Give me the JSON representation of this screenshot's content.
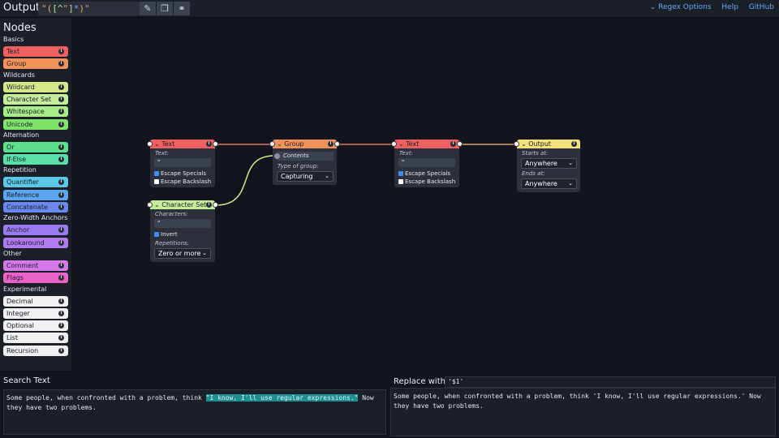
{
  "topbar": {
    "output_label": "Output:",
    "regex": "\"([^\"]*)\"",
    "links": {
      "regex_options": "Regex Options",
      "help": "Help",
      "github": "GitHub"
    }
  },
  "sidebar": {
    "title": "Nodes",
    "categories": [
      {
        "label": "Basics",
        "items": [
          "Text",
          "Group"
        ]
      },
      {
        "label": "Wildcards",
        "items": [
          "Wildcard",
          "Character Set",
          "Whitespace",
          "Unicode"
        ]
      },
      {
        "label": "Alternation",
        "items": [
          "Or",
          "If-Else"
        ]
      },
      {
        "label": "Repetition",
        "items": [
          "Quantifier",
          "Reference",
          "Concatenate"
        ]
      },
      {
        "label": "Zero-Width Anchors",
        "items": [
          "Anchor",
          "Lookaround"
        ]
      },
      {
        "label": "Other",
        "items": [
          "Comment",
          "Flags"
        ]
      },
      {
        "label": "Experimental",
        "items": [
          "Decimal",
          "Integer",
          "Optional",
          "List",
          "Recursion"
        ]
      }
    ],
    "colors": [
      "#f06060",
      "#f0925a",
      "#d4e88a",
      "#c4ee9c",
      "#a8ec8a",
      "#7fe36a",
      "#5ae08a",
      "#5ae0a8",
      "#5ac8e6",
      "#5aa6f0",
      "#6a88f0",
      "#9a7af0",
      "#b07af0",
      "#d478ea",
      "#ea62c8",
      "#f0f0f0",
      "#f0f0f0",
      "#f0f0f0",
      "#f0f0f0",
      "#f0f0f0"
    ]
  },
  "nodes": {
    "text1": {
      "title": "Text",
      "field_label": "Text:",
      "value": "\"",
      "check1": "Escape Specials",
      "check2": "Escape Backslash",
      "color": "#f06060"
    },
    "charset": {
      "title": "Character Set",
      "field_label": "Characters:",
      "value": "\"",
      "check": "Invert",
      "rep_label": "Repetitions:",
      "rep_value": "Zero or more",
      "color": "#c4ee9c"
    },
    "group": {
      "title": "Group",
      "contents": "Contents",
      "type_label": "Type of group:",
      "type_value": "Capturing",
      "color": "#f0925a"
    },
    "text2": {
      "title": "Text",
      "field_label": "Text:",
      "value": "\"",
      "check1": "Escape Specials",
      "check2": "Escape Backslash",
      "color": "#f06060"
    },
    "output": {
      "title": "Output",
      "start_label": "Starts at:",
      "start_value": "Anywhere",
      "end_label": "Ends at:",
      "end_value": "Anywhere",
      "color": "#f2e07a"
    }
  },
  "search": {
    "title": "Search Text",
    "before": "Some people, when confronted with a problem, think ",
    "match": "\"I know, I'll use regular expressions.\"",
    "after": " Now they have two problems."
  },
  "replace": {
    "label": "Replace with:",
    "value": "'$1'",
    "result": "Some people, when confronted with a problem, think 'I know, I'll use regular expressions.' Now they have two problems."
  }
}
